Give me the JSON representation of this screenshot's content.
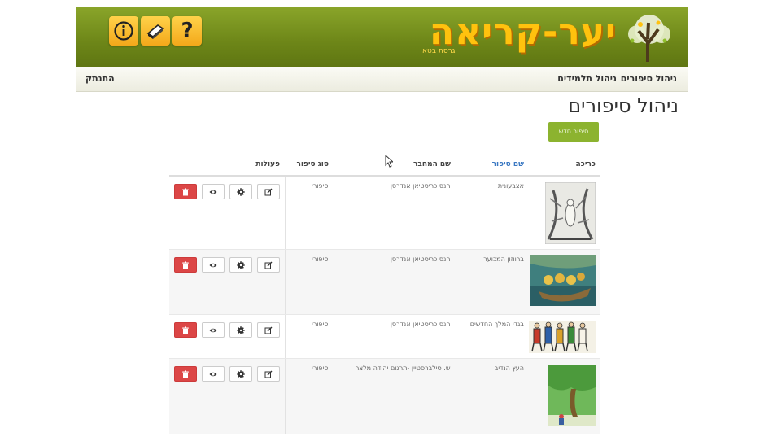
{
  "header": {
    "logo_text": "יער-קריאה",
    "logo_subtitle": "גרסת בטא",
    "buttons": [
      {
        "icon": "info-icon"
      },
      {
        "icon": "book-icon"
      },
      {
        "icon": "help-icon",
        "label": "?"
      }
    ]
  },
  "nav": {
    "stories": "ניהול סיפורים",
    "students": "ניהול תלמידים",
    "logout": "התנתק"
  },
  "page": {
    "title": "ניהול סיפורים",
    "new_story_button": "סיפור חדש"
  },
  "table": {
    "headers": {
      "cover": "כריכה",
      "story_name": "שם סיפור",
      "author": "שם המחבר",
      "type": "סוג סיפור",
      "actions": "פעולות"
    },
    "rows": [
      {
        "cover_icon": "book-cover-woodcut",
        "name": "אצבעונית",
        "author": "הנס כריסטיאן אנדרסן",
        "type": "סיפורי"
      },
      {
        "cover_icon": "book-cover-ducklings",
        "name": "ברווזון המכוער",
        "author": "הנס כריסטיאן אנדרסן",
        "type": "סיפורי"
      },
      {
        "cover_icon": "book-cover-soldiers",
        "name": "בגדי המלך החדשים",
        "author": "הנס כריסטיאן אנדרסן",
        "type": "סיפורי"
      },
      {
        "cover_icon": "book-cover-tree",
        "name": "העץ הנדיב",
        "author": "ש. סילברסטיין -תרגום יהודה מלצר",
        "type": "סיפורי"
      }
    ],
    "action_icons": [
      "edit-icon",
      "gear-icon",
      "eye-icon",
      "trash-icon"
    ]
  },
  "colors": {
    "header_green": "#6d8618",
    "logo_yellow": "#ffc20e",
    "button_green": "#8cb32f",
    "delete_red": "#dc4646",
    "link_blue": "#3a78c2"
  }
}
